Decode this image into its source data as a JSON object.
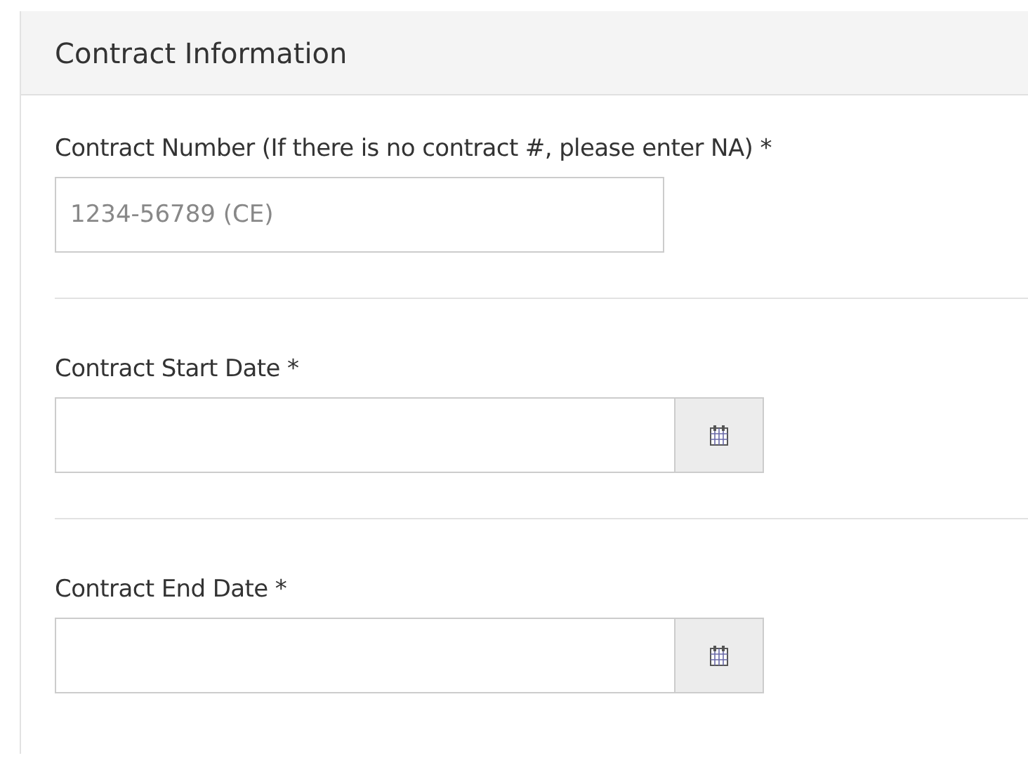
{
  "section": {
    "title": "Contract Information"
  },
  "fields": [
    {
      "kind": "text",
      "label": "Contract Number (If there is no contract #, please enter NA) *",
      "placeholder": "1234-56789 (CE)"
    },
    {
      "kind": "date",
      "label": "Contract Start Date *"
    },
    {
      "kind": "date",
      "label": "Contract End Date *"
    }
  ]
}
